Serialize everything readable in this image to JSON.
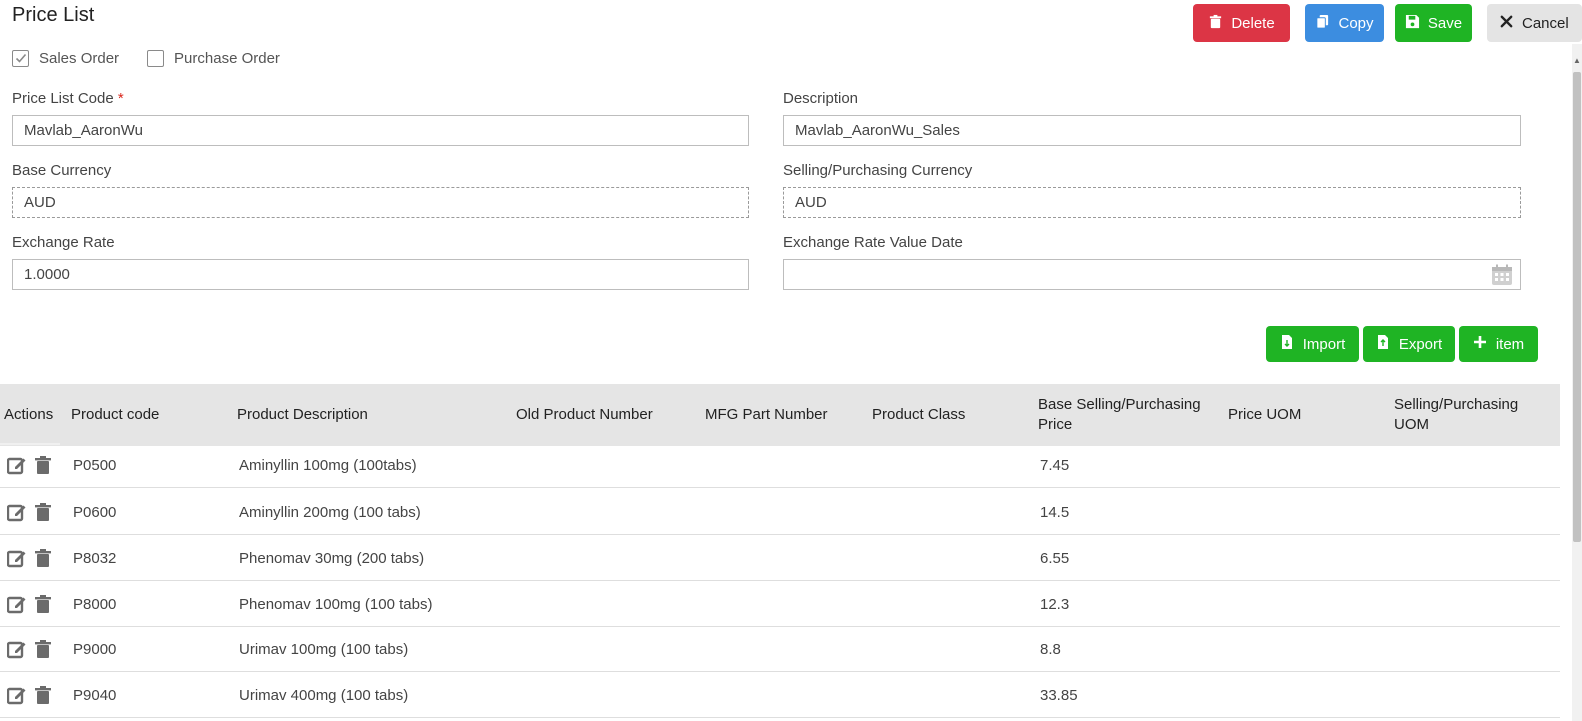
{
  "page": {
    "title": "Price List"
  },
  "toolbar": {
    "delete_label": "Delete",
    "copy_label": "Copy",
    "save_label": "Save",
    "cancel_label": "Cancel"
  },
  "order_types": {
    "sales": {
      "label": "Sales Order",
      "checked": true
    },
    "purchase": {
      "label": "Purchase Order",
      "checked": false
    }
  },
  "form": {
    "price_list_code": {
      "label": "Price List Code",
      "required_mark": "*",
      "value": "Mavlab_AaronWu"
    },
    "description": {
      "label": "Description",
      "value": "Mavlab_AaronWu_Sales"
    },
    "base_currency": {
      "label": "Base Currency",
      "value": "AUD"
    },
    "selling_currency": {
      "label": "Selling/Purchasing Currency",
      "value": "AUD"
    },
    "exchange_rate": {
      "label": "Exchange Rate",
      "value": "1.0000"
    },
    "exchange_rate_date": {
      "label": "Exchange Rate Value Date",
      "value": ""
    }
  },
  "table_tools": {
    "import_label": "Import",
    "export_label": "Export",
    "add_item_label": "item"
  },
  "table": {
    "headers": {
      "actions": "Actions",
      "product_code": "Product code",
      "product_description": "Product Description",
      "old_product_number": "Old Product Number",
      "mfg_part_number": "MFG Part Number",
      "product_class": "Product Class",
      "base_price_line1": "Base Selling/Purchasing",
      "base_price_line2": "Price",
      "price_uom": "Price UOM",
      "selling_uom_line1": "Selling/Purchasing",
      "selling_uom_line2": "UOM"
    },
    "rows": [
      {
        "code": "P0500",
        "description": "Aminyllin 100mg (100tabs)",
        "price": "7.45"
      },
      {
        "code": "P0600",
        "description": "Aminyllin 200mg (100 tabs)",
        "price": "14.5"
      },
      {
        "code": "P8032",
        "description": "Phenomav 30mg (200 tabs)",
        "price": "6.55"
      },
      {
        "code": "P8000",
        "description": "Phenomav 100mg (100 tabs)",
        "price": "12.3"
      },
      {
        "code": "P9000",
        "description": "Urimav 100mg (100 tabs)",
        "price": "8.8"
      },
      {
        "code": "P9040",
        "description": "Urimav 400mg (100 tabs)",
        "price": "33.85"
      }
    ]
  },
  "colors": {
    "delete": "#dc3545",
    "copy": "#3c8de0",
    "save": "#1fb424",
    "cancel": "#e4e4e4",
    "table_header": "#e5e5e5",
    "required": "#d9261c"
  },
  "icons": {
    "delete": "trash-icon",
    "copy": "copy-icon",
    "save": "floppy-icon",
    "cancel": "close-icon",
    "import": "file-import-icon",
    "export": "file-export-icon",
    "add": "plus-icon",
    "date": "calendar-icon",
    "row_edit": "edit-icon",
    "row_delete": "trash-icon"
  }
}
